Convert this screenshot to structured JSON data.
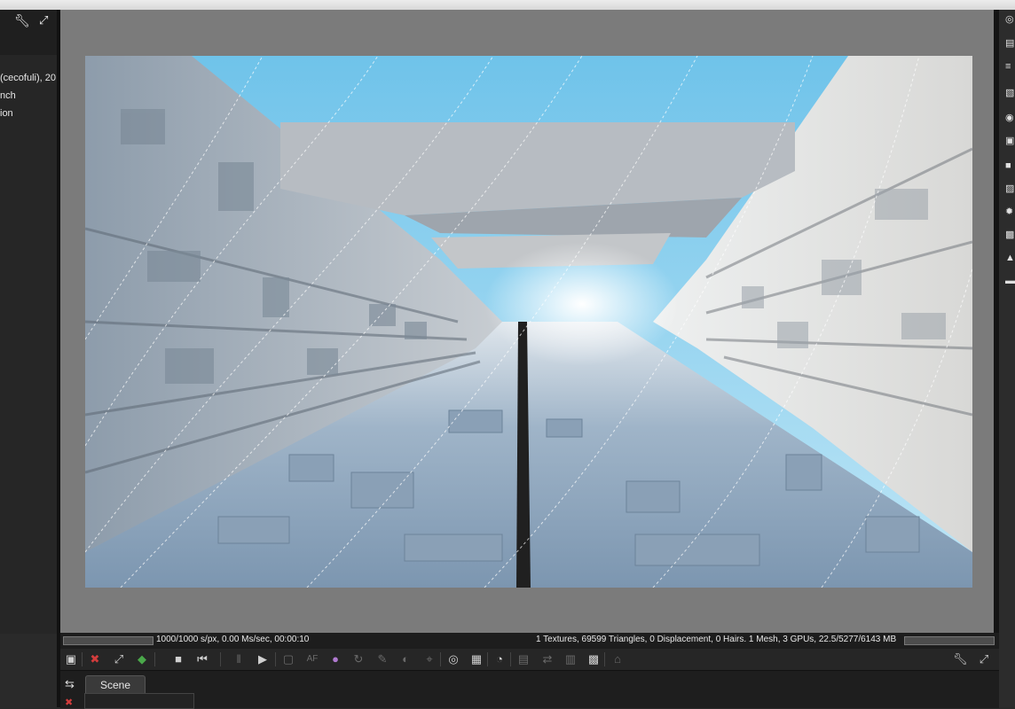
{
  "left_panel": {
    "lines": [
      "(cecofuli), 20",
      "nch",
      "ion"
    ]
  },
  "status": {
    "left_text": "1000/1000 s/px, 0.00 Ms/sec, 00:00:10",
    "right_text": "1 Textures, 69599 Triangles, 0 Displacement, 0 Hairs. 1 Mesh, 3 GPUs, 22.5/5277/6143 MB"
  },
  "toolbar": {
    "icons": [
      "save-image-icon",
      "reset-icon",
      "fit-view-icon",
      "cube-icon",
      "stop-icon",
      "restart-icon",
      "pause-icon",
      "play-icon",
      "monitor-icon",
      "af-icon",
      "color-icon",
      "refresh-icon",
      "picker-icon",
      "material-icon",
      "focus-icon",
      "region-icon",
      "grid-icon",
      "gauge-icon",
      "layers-icon",
      "transfer-icon",
      "stack-icon",
      "checker-icon",
      "lock-icon"
    ],
    "af_label": "AF"
  },
  "tabs": {
    "scene_label": "Scene"
  },
  "colors": {
    "accent_red": "#d23c3c",
    "sky": "#8fd3ee",
    "concrete": "#c9ccd0"
  }
}
